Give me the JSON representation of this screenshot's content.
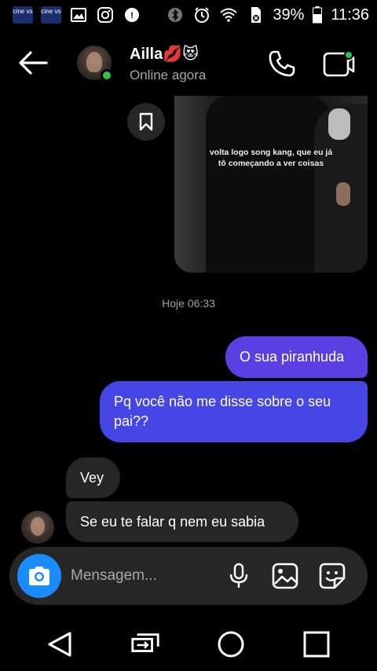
{
  "status_bar": {
    "app_badge_1": "cine vs",
    "app_badge_2": "cine vs",
    "battery": "39%",
    "time": "11:36"
  },
  "header": {
    "contact_name": "Ailla💋😻",
    "contact_status": "Online agora"
  },
  "media": {
    "caption_line1": "volta logo song kang, que eu já",
    "caption_line2": "tô começando a ver coisas"
  },
  "conversation": {
    "timestamp": "Hoje 06:33",
    "messages": [
      {
        "direction": "sent",
        "text": "O sua piranhuda"
      },
      {
        "direction": "sent",
        "text": "Pq você não me disse sobre o seu pai??"
      },
      {
        "direction": "received",
        "text": "Vey"
      },
      {
        "direction": "received",
        "text": "Se eu te falar q nem eu sabia"
      }
    ]
  },
  "composer": {
    "placeholder": "Mensagem..."
  },
  "colors": {
    "sent_bubble_1": "#5a3fe3",
    "sent_bubble_2": "#4646e6",
    "received_bubble": "#262626",
    "camera_button": "#1a8cff",
    "online_indicator": "#2fc14b"
  },
  "icons": [
    "back-arrow-icon",
    "phone-icon",
    "video-call-icon",
    "bookmark-icon",
    "camera-icon",
    "microphone-icon",
    "image-icon",
    "sticker-icon",
    "nav-back-icon",
    "nav-switch-icon",
    "nav-home-icon",
    "nav-recents-icon"
  ]
}
